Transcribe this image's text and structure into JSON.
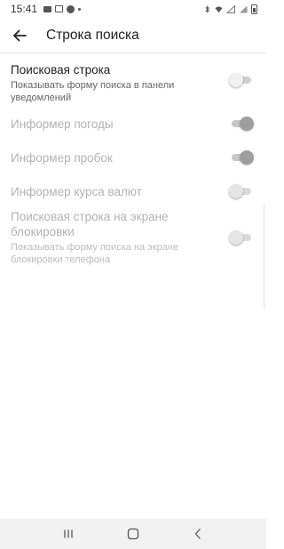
{
  "status_bar": {
    "time": "15:41"
  },
  "header": {
    "back_icon": "arrow-left-icon",
    "title": "Строка поиска"
  },
  "settings": [
    {
      "title": "Поисковая строка",
      "subtitle": "Показывать форму поиска в панели уведомлений",
      "enabled": true,
      "checked": false
    },
    {
      "title": "Информер погоды",
      "subtitle": "",
      "enabled": false,
      "checked": true
    },
    {
      "title": "Информер пробок",
      "subtitle": "",
      "enabled": false,
      "checked": true
    },
    {
      "title": "Информер курса валют",
      "subtitle": "",
      "enabled": false,
      "checked": false
    },
    {
      "title": "Поисковая строка на экране блокировки",
      "subtitle": "Показывать форму поиска на экране блокировки телефона",
      "enabled": false,
      "checked": false
    }
  ],
  "nav_bar": {
    "recents_icon": "recents-icon",
    "home_icon": "home-icon",
    "back_icon": "back-chevron-icon"
  },
  "colors": {
    "background": "#ffffff",
    "text_primary": "#222222",
    "text_disabled": "#b3b3b3",
    "nav_background": "#f2f2f2"
  }
}
